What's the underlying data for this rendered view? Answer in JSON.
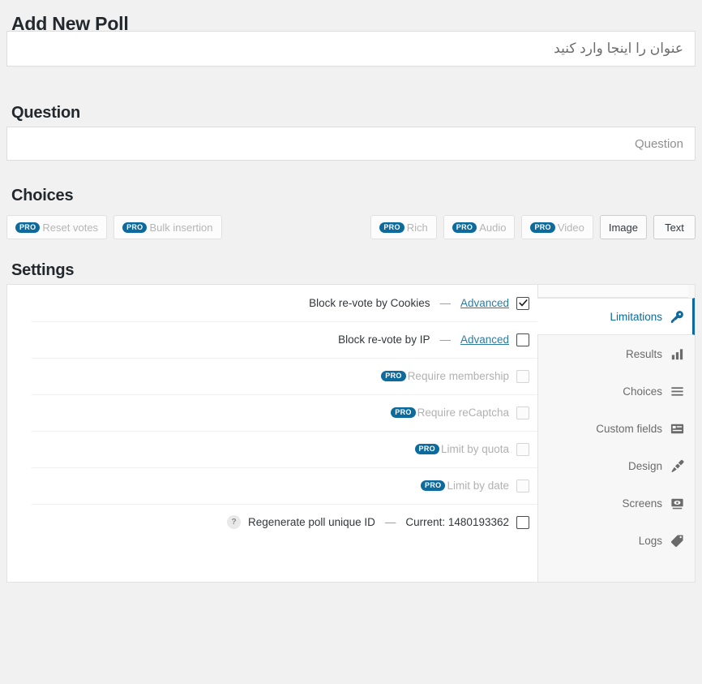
{
  "page": {
    "title": "Add New Poll",
    "title_input_placeholder": "عنوان را اینجا وارد کنید",
    "title_input_value": ""
  },
  "question": {
    "heading": "Question",
    "input_placeholder": "Question",
    "input_value": ""
  },
  "choices": {
    "heading": "Choices",
    "pro_label": "PRO",
    "left_buttons": [
      {
        "label": "Reset votes",
        "pro": true
      },
      {
        "label": "Bulk insertion",
        "pro": true
      }
    ],
    "type_buttons": [
      {
        "label": "Rich",
        "pro": true,
        "active": false
      },
      {
        "label": "Audio",
        "pro": true,
        "active": false
      },
      {
        "label": "Video",
        "pro": true,
        "active": false
      },
      {
        "label": "Image",
        "pro": false,
        "active": true
      },
      {
        "label": "Text",
        "pro": false,
        "active": true
      }
    ]
  },
  "settings": {
    "heading": "Settings",
    "tabs": [
      {
        "label": "Limitations",
        "icon": "key-icon",
        "active": true
      },
      {
        "label": "Results",
        "icon": "bar-chart-icon",
        "active": false
      },
      {
        "label": "Choices",
        "icon": "list-icon",
        "active": false
      },
      {
        "label": "Custom fields",
        "icon": "form-fields-icon",
        "active": false
      },
      {
        "label": "Design",
        "icon": "paintbrush-icon",
        "active": false
      },
      {
        "label": "Screens",
        "icon": "screen-icon",
        "active": false
      },
      {
        "label": "Logs",
        "icon": "tag-icon",
        "active": false
      }
    ],
    "dash": "—",
    "rows": [
      {
        "label": "Block re-vote by Cookies",
        "link": "Advanced",
        "checked": true,
        "pro": false,
        "disabled": false
      },
      {
        "label": "Block re-vote by IP",
        "link": "Advanced",
        "checked": false,
        "pro": false,
        "disabled": false
      },
      {
        "label": "Require membership",
        "link": "",
        "checked": false,
        "pro": true,
        "disabled": true
      },
      {
        "label": "Require reCaptcha",
        "link": "",
        "checked": false,
        "pro": true,
        "disabled": true
      },
      {
        "label": "Limit by quota",
        "link": "",
        "checked": false,
        "pro": true,
        "disabled": true
      },
      {
        "label": "Limit by date",
        "link": "",
        "checked": false,
        "pro": true,
        "disabled": true
      },
      {
        "label": "Regenerate poll unique ID",
        "link": "",
        "current": "Current: 1480193362",
        "help": "?",
        "checked": false,
        "pro": false,
        "disabled": false
      }
    ]
  },
  "colors": {
    "accent": "#0d6a9c",
    "link": "#2d7ba0",
    "page_bg": "#f1f1f1",
    "panel_bg": "#ffffff",
    "sidebar_bg": "#f7f7f7",
    "text": "#32373c",
    "muted": "#b1b1b1"
  }
}
